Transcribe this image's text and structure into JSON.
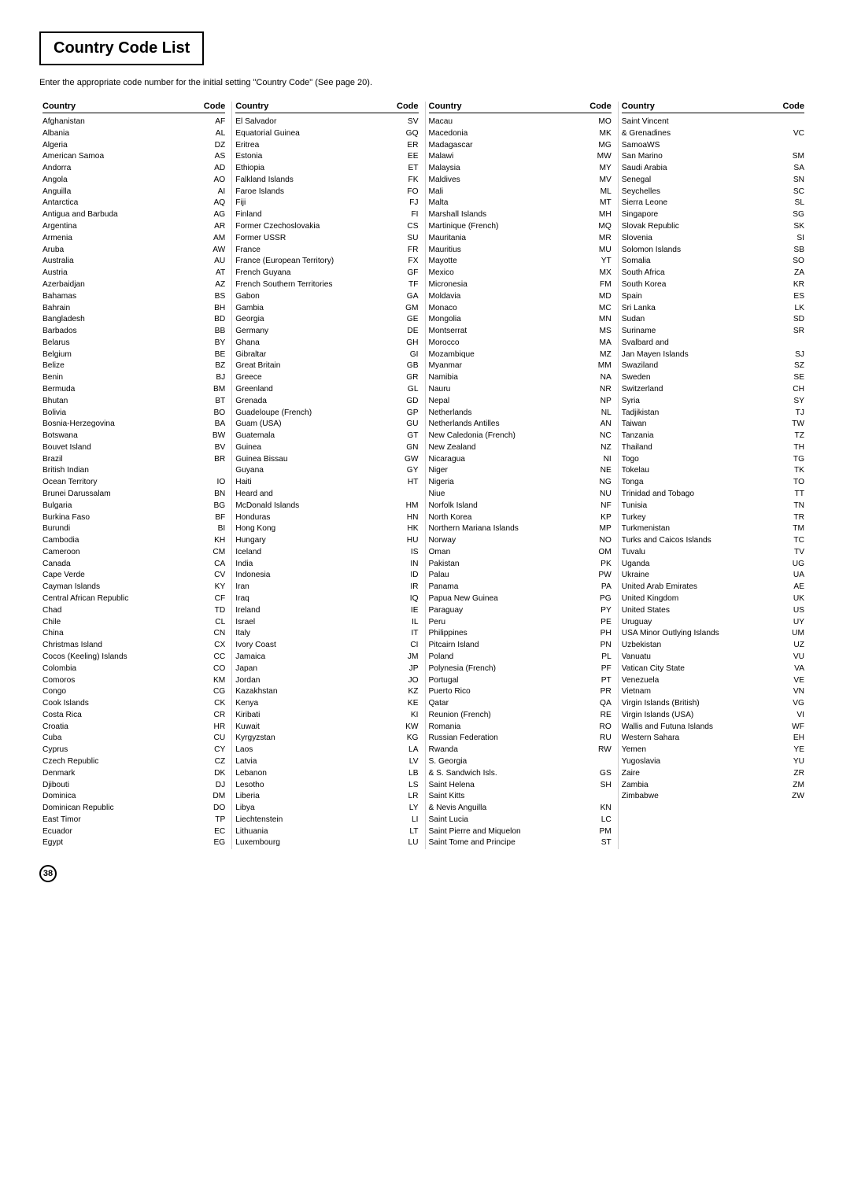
{
  "title": "Country Code List",
  "subtitle": "Enter the appropriate code number for the initial setting \"Country Code\" (See page 20).",
  "page_number": "38",
  "col1_header": {
    "country": "Country",
    "code": "Code"
  },
  "col2_header": {
    "country": "Country",
    "code": "Code"
  },
  "col3_header": {
    "country": "Country",
    "code": "Code"
  },
  "col4_header": {
    "country": "Country",
    "code": "Code"
  },
  "col1": [
    {
      "name": "Afghanistan",
      "code": "AF"
    },
    {
      "name": "Albania",
      "code": "AL"
    },
    {
      "name": "Algeria",
      "code": "DZ"
    },
    {
      "name": "American Samoa",
      "code": "AS"
    },
    {
      "name": "Andorra",
      "code": "AD"
    },
    {
      "name": "Angola",
      "code": "AO"
    },
    {
      "name": "Anguilla",
      "code": "AI"
    },
    {
      "name": "Antarctica",
      "code": "AQ"
    },
    {
      "name": "Antigua and Barbuda",
      "code": "AG"
    },
    {
      "name": "Argentina",
      "code": "AR"
    },
    {
      "name": "Armenia",
      "code": "AM"
    },
    {
      "name": "Aruba",
      "code": "AW"
    },
    {
      "name": "Australia",
      "code": "AU"
    },
    {
      "name": "Austria",
      "code": "AT"
    },
    {
      "name": "Azerbaidjan",
      "code": "AZ"
    },
    {
      "name": "Bahamas",
      "code": "BS"
    },
    {
      "name": "Bahrain",
      "code": "BH"
    },
    {
      "name": "Bangladesh",
      "code": "BD"
    },
    {
      "name": "Barbados",
      "code": "BB"
    },
    {
      "name": "Belarus",
      "code": "BY"
    },
    {
      "name": "Belgium",
      "code": "BE"
    },
    {
      "name": "Belize",
      "code": "BZ"
    },
    {
      "name": "Benin",
      "code": "BJ"
    },
    {
      "name": "Bermuda",
      "code": "BM"
    },
    {
      "name": "Bhutan",
      "code": "BT"
    },
    {
      "name": "Bolivia",
      "code": "BO"
    },
    {
      "name": "Bosnia-Herzegovina",
      "code": "BA"
    },
    {
      "name": "Botswana",
      "code": "BW"
    },
    {
      "name": "Bouvet Island",
      "code": "BV"
    },
    {
      "name": "Brazil",
      "code": "BR"
    },
    {
      "name": "British Indian",
      "code": ""
    },
    {
      "name": "    Ocean Territory",
      "code": "IO"
    },
    {
      "name": "Brunei Darussalam",
      "code": "BN"
    },
    {
      "name": "Bulgaria",
      "code": "BG"
    },
    {
      "name": "Burkina Faso",
      "code": "BF"
    },
    {
      "name": "Burundi",
      "code": "BI"
    },
    {
      "name": "Cambodia",
      "code": "KH"
    },
    {
      "name": "Cameroon",
      "code": "CM"
    },
    {
      "name": "Canada",
      "code": "CA"
    },
    {
      "name": "Cape Verde",
      "code": "CV"
    },
    {
      "name": "Cayman Islands",
      "code": "KY"
    },
    {
      "name": "Central African Republic",
      "code": "CF"
    },
    {
      "name": "Chad",
      "code": "TD"
    },
    {
      "name": "Chile",
      "code": "CL"
    },
    {
      "name": "China",
      "code": "CN"
    },
    {
      "name": "Christmas Island",
      "code": "CX"
    },
    {
      "name": "Cocos (Keeling) Islands",
      "code": "CC"
    },
    {
      "name": "Colombia",
      "code": "CO"
    },
    {
      "name": "Comoros",
      "code": "KM"
    },
    {
      "name": "Congo",
      "code": "CG"
    },
    {
      "name": "Cook Islands",
      "code": "CK"
    },
    {
      "name": "Costa Rica",
      "code": "CR"
    },
    {
      "name": "Croatia",
      "code": "HR"
    },
    {
      "name": "Cuba",
      "code": "CU"
    },
    {
      "name": "Cyprus",
      "code": "CY"
    },
    {
      "name": "Czech Republic",
      "code": "CZ"
    },
    {
      "name": "Denmark",
      "code": "DK"
    },
    {
      "name": "Djibouti",
      "code": "DJ"
    },
    {
      "name": "Dominica",
      "code": "DM"
    },
    {
      "name": "Dominican Republic",
      "code": "DO"
    },
    {
      "name": "East Timor",
      "code": "TP"
    },
    {
      "name": "Ecuador",
      "code": "EC"
    },
    {
      "name": "Egypt",
      "code": "EG"
    }
  ],
  "col2": [
    {
      "name": "El Salvador",
      "code": "SV"
    },
    {
      "name": "Equatorial Guinea",
      "code": "GQ"
    },
    {
      "name": "Eritrea",
      "code": "ER"
    },
    {
      "name": "Estonia",
      "code": "EE"
    },
    {
      "name": "Ethiopia",
      "code": "ET"
    },
    {
      "name": "Falkland Islands",
      "code": "FK"
    },
    {
      "name": "Faroe Islands",
      "code": "FO"
    },
    {
      "name": "Fiji",
      "code": "FJ"
    },
    {
      "name": "Finland",
      "code": "FI"
    },
    {
      "name": "Former Czechoslovakia",
      "code": "CS"
    },
    {
      "name": "Former USSR",
      "code": "SU"
    },
    {
      "name": "France",
      "code": "FR"
    },
    {
      "name": "France (European Territory)",
      "code": "FX"
    },
    {
      "name": "French Guyana",
      "code": "GF"
    },
    {
      "name": "French Southern Territories",
      "code": "TF"
    },
    {
      "name": "Gabon",
      "code": "GA"
    },
    {
      "name": "Gambia",
      "code": "GM"
    },
    {
      "name": "Georgia",
      "code": "GE"
    },
    {
      "name": "Germany",
      "code": "DE"
    },
    {
      "name": "Ghana",
      "code": "GH"
    },
    {
      "name": "Gibraltar",
      "code": "GI"
    },
    {
      "name": "Great Britain",
      "code": "GB"
    },
    {
      "name": "Greece",
      "code": "GR"
    },
    {
      "name": "Greenland",
      "code": "GL"
    },
    {
      "name": "Grenada",
      "code": "GD"
    },
    {
      "name": "Guadeloupe (French)",
      "code": "GP"
    },
    {
      "name": "Guam (USA)",
      "code": "GU"
    },
    {
      "name": "Guatemala",
      "code": "GT"
    },
    {
      "name": "Guinea",
      "code": "GN"
    },
    {
      "name": "Guinea Bissau",
      "code": "GW"
    },
    {
      "name": "Guyana",
      "code": "GY"
    },
    {
      "name": "Haiti",
      "code": "HT"
    },
    {
      "name": "Heard and",
      "code": ""
    },
    {
      "name": "    McDonald Islands",
      "code": "HM"
    },
    {
      "name": "Honduras",
      "code": "HN"
    },
    {
      "name": "Hong Kong",
      "code": "HK"
    },
    {
      "name": "Hungary",
      "code": "HU"
    },
    {
      "name": "Iceland",
      "code": "IS"
    },
    {
      "name": "India",
      "code": "IN"
    },
    {
      "name": "Indonesia",
      "code": "ID"
    },
    {
      "name": "Iran",
      "code": "IR"
    },
    {
      "name": "Iraq",
      "code": "IQ"
    },
    {
      "name": "Ireland",
      "code": "IE"
    },
    {
      "name": "Israel",
      "code": "IL"
    },
    {
      "name": "Italy",
      "code": "IT"
    },
    {
      "name": "Ivory Coast",
      "code": "CI"
    },
    {
      "name": "Jamaica",
      "code": "JM"
    },
    {
      "name": "Japan",
      "code": "JP"
    },
    {
      "name": "Jordan",
      "code": "JO"
    },
    {
      "name": "Kazakhstan",
      "code": "KZ"
    },
    {
      "name": "Kenya",
      "code": "KE"
    },
    {
      "name": "Kiribati",
      "code": "KI"
    },
    {
      "name": "Kuwait",
      "code": "KW"
    },
    {
      "name": "Kyrgyzstan",
      "code": "KG"
    },
    {
      "name": "Laos",
      "code": "LA"
    },
    {
      "name": "Latvia",
      "code": "LV"
    },
    {
      "name": "Lebanon",
      "code": "LB"
    },
    {
      "name": "Lesotho",
      "code": "LS"
    },
    {
      "name": "Liberia",
      "code": "LR"
    },
    {
      "name": "Libya",
      "code": "LY"
    },
    {
      "name": "Liechtenstein",
      "code": "LI"
    },
    {
      "name": "Lithuania",
      "code": "LT"
    },
    {
      "name": "Luxembourg",
      "code": "LU"
    }
  ],
  "col3": [
    {
      "name": "Macau",
      "code": "MO"
    },
    {
      "name": "Macedonia",
      "code": "MK"
    },
    {
      "name": "Madagascar",
      "code": "MG"
    },
    {
      "name": "Malawi",
      "code": "MW"
    },
    {
      "name": "Malaysia",
      "code": "MY"
    },
    {
      "name": "Maldives",
      "code": "MV"
    },
    {
      "name": "Mali",
      "code": "ML"
    },
    {
      "name": "Malta",
      "code": "MT"
    },
    {
      "name": "Marshall Islands",
      "code": "MH"
    },
    {
      "name": "Martinique (French)",
      "code": "MQ"
    },
    {
      "name": "Mauritania",
      "code": "MR"
    },
    {
      "name": "Mauritius",
      "code": "MU"
    },
    {
      "name": "Mayotte",
      "code": "YT"
    },
    {
      "name": "Mexico",
      "code": "MX"
    },
    {
      "name": "Micronesia",
      "code": "FM"
    },
    {
      "name": "Moldavia",
      "code": "MD"
    },
    {
      "name": "Monaco",
      "code": "MC"
    },
    {
      "name": "Mongolia",
      "code": "MN"
    },
    {
      "name": "Montserrat",
      "code": "MS"
    },
    {
      "name": "Morocco",
      "code": "MA"
    },
    {
      "name": "Mozambique",
      "code": "MZ"
    },
    {
      "name": "Myanmar",
      "code": "MM"
    },
    {
      "name": "Namibia",
      "code": "NA"
    },
    {
      "name": "Nauru",
      "code": "NR"
    },
    {
      "name": "Nepal",
      "code": "NP"
    },
    {
      "name": "Netherlands",
      "code": "NL"
    },
    {
      "name": "Netherlands Antilles",
      "code": "AN"
    },
    {
      "name": "New Caledonia (French)",
      "code": "NC"
    },
    {
      "name": "New Zealand",
      "code": "NZ"
    },
    {
      "name": "Nicaragua",
      "code": "NI"
    },
    {
      "name": "Niger",
      "code": "NE"
    },
    {
      "name": "Nigeria",
      "code": "NG"
    },
    {
      "name": "Niue",
      "code": "NU"
    },
    {
      "name": "Norfolk Island",
      "code": "NF"
    },
    {
      "name": "North Korea",
      "code": "KP"
    },
    {
      "name": "Northern Mariana Islands",
      "code": "MP"
    },
    {
      "name": "Norway",
      "code": "NO"
    },
    {
      "name": "Oman",
      "code": "OM"
    },
    {
      "name": "Pakistan",
      "code": "PK"
    },
    {
      "name": "Palau",
      "code": "PW"
    },
    {
      "name": "Panama",
      "code": "PA"
    },
    {
      "name": "Papua New Guinea",
      "code": "PG"
    },
    {
      "name": "Paraguay",
      "code": "PY"
    },
    {
      "name": "Peru",
      "code": "PE"
    },
    {
      "name": "Philippines",
      "code": "PH"
    },
    {
      "name": "Pitcairn Island",
      "code": "PN"
    },
    {
      "name": "Poland",
      "code": "PL"
    },
    {
      "name": "Polynesia (French)",
      "code": "PF"
    },
    {
      "name": "Portugal",
      "code": "PT"
    },
    {
      "name": "Puerto Rico",
      "code": "PR"
    },
    {
      "name": "Qatar",
      "code": "QA"
    },
    {
      "name": "Reunion (French)",
      "code": "RE"
    },
    {
      "name": "Romania",
      "code": "RO"
    },
    {
      "name": "Russian Federation",
      "code": "RU"
    },
    {
      "name": "Rwanda",
      "code": "RW"
    },
    {
      "name": "S. Georgia",
      "code": ""
    },
    {
      "name": "    & S. Sandwich Isls.",
      "code": "GS"
    },
    {
      "name": "Saint Helena",
      "code": "SH"
    },
    {
      "name": "Saint Kitts",
      "code": ""
    },
    {
      "name": "    & Nevis Anguilla",
      "code": "KN"
    },
    {
      "name": "Saint Lucia",
      "code": "LC"
    },
    {
      "name": "Saint Pierre and Miquelon",
      "code": "PM"
    },
    {
      "name": "Saint Tome and Principe",
      "code": "ST"
    }
  ],
  "col4": [
    {
      "name": "Saint Vincent",
      "code": ""
    },
    {
      "name": "    & Grenadines",
      "code": "VC"
    },
    {
      "name": "SamoaWS",
      "code": ""
    },
    {
      "name": "San Marino",
      "code": "SM"
    },
    {
      "name": "Saudi Arabia",
      "code": "SA"
    },
    {
      "name": "Senegal",
      "code": "SN"
    },
    {
      "name": "Seychelles",
      "code": "SC"
    },
    {
      "name": "Sierra Leone",
      "code": "SL"
    },
    {
      "name": "Singapore",
      "code": "SG"
    },
    {
      "name": "Slovak Republic",
      "code": "SK"
    },
    {
      "name": "Slovenia",
      "code": "SI"
    },
    {
      "name": "Solomon Islands",
      "code": "SB"
    },
    {
      "name": "Somalia",
      "code": "SO"
    },
    {
      "name": "South Africa",
      "code": "ZA"
    },
    {
      "name": "South Korea",
      "code": "KR"
    },
    {
      "name": "Spain",
      "code": "ES"
    },
    {
      "name": "Sri Lanka",
      "code": "LK"
    },
    {
      "name": "Sudan",
      "code": "SD"
    },
    {
      "name": "Suriname",
      "code": "SR"
    },
    {
      "name": "Svalbard and",
      "code": ""
    },
    {
      "name": "    Jan Mayen Islands",
      "code": "SJ"
    },
    {
      "name": "Swaziland",
      "code": "SZ"
    },
    {
      "name": "Sweden",
      "code": "SE"
    },
    {
      "name": "Switzerland",
      "code": "CH"
    },
    {
      "name": "Syria",
      "code": "SY"
    },
    {
      "name": "Tadjikistan",
      "code": "TJ"
    },
    {
      "name": "Taiwan",
      "code": "TW"
    },
    {
      "name": "Tanzania",
      "code": "TZ"
    },
    {
      "name": "Thailand",
      "code": "TH"
    },
    {
      "name": "Togo",
      "code": "TG"
    },
    {
      "name": "Tokelau",
      "code": "TK"
    },
    {
      "name": "Tonga",
      "code": "TO"
    },
    {
      "name": "Trinidad and Tobago",
      "code": "TT"
    },
    {
      "name": "Tunisia",
      "code": "TN"
    },
    {
      "name": "Turkey",
      "code": "TR"
    },
    {
      "name": "Turkmenistan",
      "code": "TM"
    },
    {
      "name": "Turks and Caicos Islands",
      "code": "TC"
    },
    {
      "name": "Tuvalu",
      "code": "TV"
    },
    {
      "name": "Uganda",
      "code": "UG"
    },
    {
      "name": "Ukraine",
      "code": "UA"
    },
    {
      "name": "United Arab Emirates",
      "code": "AE"
    },
    {
      "name": "United Kingdom",
      "code": "UK"
    },
    {
      "name": "United States",
      "code": "US"
    },
    {
      "name": "Uruguay",
      "code": "UY"
    },
    {
      "name": "USA Minor Outlying Islands",
      "code": "UM"
    },
    {
      "name": "Uzbekistan",
      "code": "UZ"
    },
    {
      "name": "Vanuatu",
      "code": "VU"
    },
    {
      "name": "Vatican City State",
      "code": "VA"
    },
    {
      "name": "Venezuela",
      "code": "VE"
    },
    {
      "name": "Vietnam",
      "code": "VN"
    },
    {
      "name": "Virgin Islands (British)",
      "code": "VG"
    },
    {
      "name": "Virgin Islands (USA)",
      "code": "VI"
    },
    {
      "name": "Wallis and Futuna Islands",
      "code": "WF"
    },
    {
      "name": "Western Sahara",
      "code": "EH"
    },
    {
      "name": "Yemen",
      "code": "YE"
    },
    {
      "name": "Yugoslavia",
      "code": "YU"
    },
    {
      "name": "Zaire",
      "code": "ZR"
    },
    {
      "name": "Zambia",
      "code": "ZM"
    },
    {
      "name": "Zimbabwe",
      "code": "ZW"
    }
  ]
}
